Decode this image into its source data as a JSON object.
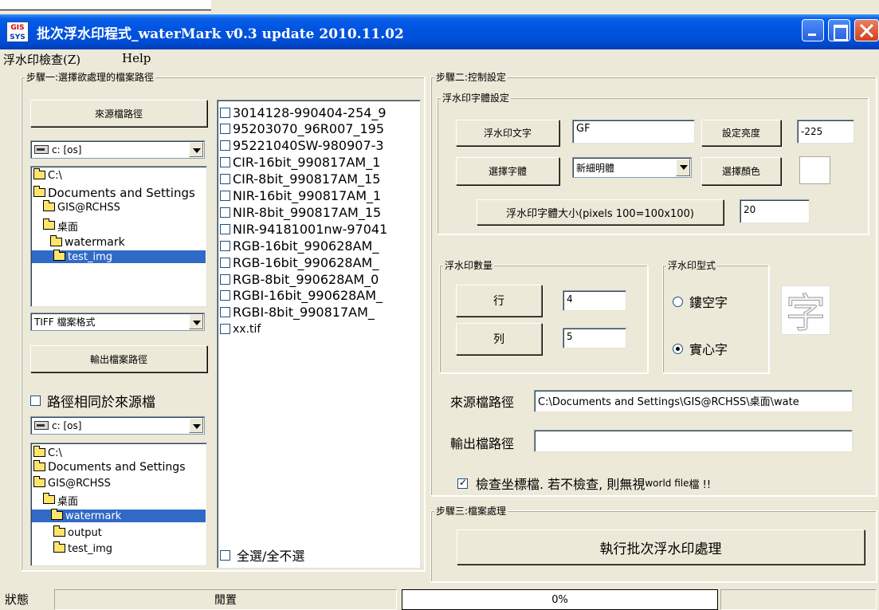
{
  "window": {
    "title": "批次浮水印程式_waterMark v0.3    update 2010.11.02",
    "app_icon_text_top": "GIS",
    "app_icon_text_bottom": "SYS"
  },
  "menu": {
    "items": [
      "浮水印檢查(Z)",
      "Help"
    ]
  },
  "step1": {
    "legend": "步驟一:選擇欲處理的檔案路徑",
    "source_button": "來源檔路徑",
    "source_drive": "c: [os]",
    "source_tree": [
      {
        "label": "C:\\",
        "selected": false
      },
      {
        "label": "Documents and Settings",
        "selected": false
      },
      {
        "label": "GIS@RCHSS",
        "selected": false
      },
      {
        "label": "桌面",
        "selected": false
      },
      {
        "label": "watermark",
        "selected": false
      },
      {
        "label": "test_img",
        "selected": true
      }
    ],
    "format_select": "TIFF 檔案格式",
    "output_button": "輸出檔案路徑",
    "same_path_label": "路徑相同於來源檔",
    "same_path_checked": false,
    "output_drive": "c: [os]",
    "output_tree": [
      {
        "label": "C:\\",
        "selected": false
      },
      {
        "label": "Documents and Settings",
        "selected": false
      },
      {
        "label": "GIS@RCHSS",
        "selected": false
      },
      {
        "label": "桌面",
        "selected": false
      },
      {
        "label": "watermark",
        "selected": true
      },
      {
        "label": "output",
        "selected": false
      },
      {
        "label": "test_img",
        "selected": false
      }
    ]
  },
  "files": {
    "items": [
      "3014128-990404-254_9",
      "95203070_96R007_195",
      "95221040SW-980907-3",
      "CIR-16bit_990817AM_1",
      "CIR-8bit_990817AM_15",
      "NIR-16bit_990817AM_1",
      "NIR-8bit_990817AM_15",
      "NIR-94181001nw-97041",
      "RGB-16bit_990628AM_",
      "RGB-16bit_990628AM_",
      "RGB-8bit_990628AM_0",
      "RGBI-16bit_990628AM_",
      "RGBI-8bit_990817AM_",
      "xx.tif"
    ],
    "select_all_label": "全選/全不選"
  },
  "step2": {
    "legend": "步驟二:控制設定",
    "font_group": {
      "legend": "浮水印字體設定",
      "text_button": "浮水印文字",
      "text_value": "GF",
      "brightness_button": "設定亮度",
      "brightness_value": "-225",
      "font_button": "選擇字體",
      "font_value": "新細明體",
      "color_button": "選擇顏色",
      "color_value": "#ffffff",
      "size_button": "浮水印字體大小(pixels 100=100x100)",
      "size_value": "20"
    },
    "count_group": {
      "legend": "浮水印數量",
      "row_button": "行",
      "row_value": "4",
      "col_button": "列",
      "col_value": "5"
    },
    "style_group": {
      "legend": "浮水印型式",
      "hollow_label": "鏤空字",
      "solid_label": "實心字",
      "selected": "solid",
      "preview_char": "字"
    },
    "source_path_label": "來源檔路徑",
    "source_path_value": "C:\\Documents and Settings\\GIS@RCHSS\\桌面\\wate",
    "output_path_label": "輸出檔路徑",
    "output_path_value": "",
    "check_coords_label": "檢查坐標檔. 若不檢查, 則無視",
    "check_coords_small": "world file",
    "check_coords_suffix": " 檔 !!",
    "check_coords_checked": true
  },
  "step3": {
    "legend": "步驟三:檔案處理",
    "run_button": "執行批次浮水印處理"
  },
  "status": {
    "label": "狀態",
    "state": "閒置",
    "progress_text": "0%",
    "progress_value": 0
  }
}
